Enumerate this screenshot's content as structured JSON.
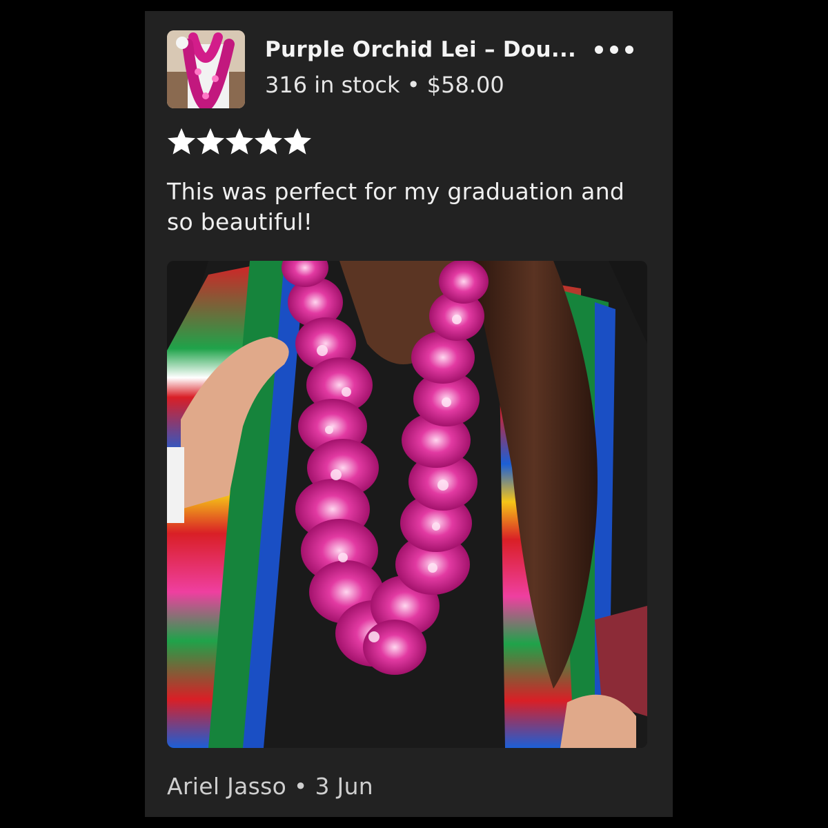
{
  "product": {
    "title": "Purple Orchid Lei – Dou...",
    "stock_and_price": "316 in stock • $58.00",
    "thumbnail_alt": "Purple orchid lei worn around neck"
  },
  "menu": {
    "icon": "more-horizontal-icon"
  },
  "rating": {
    "stars": 5,
    "max": 5,
    "color": "#ffffff"
  },
  "review": {
    "text": "This was perfect for my graduation and so beautiful!",
    "photo_alt": "Graduate wearing a purple orchid lei and serape stoles"
  },
  "footer": {
    "author_and_date": "Ariel Jasso • 3 Jun"
  },
  "colors": {
    "background": "#000000",
    "card": "#222222",
    "orchid": "#c2187e"
  }
}
